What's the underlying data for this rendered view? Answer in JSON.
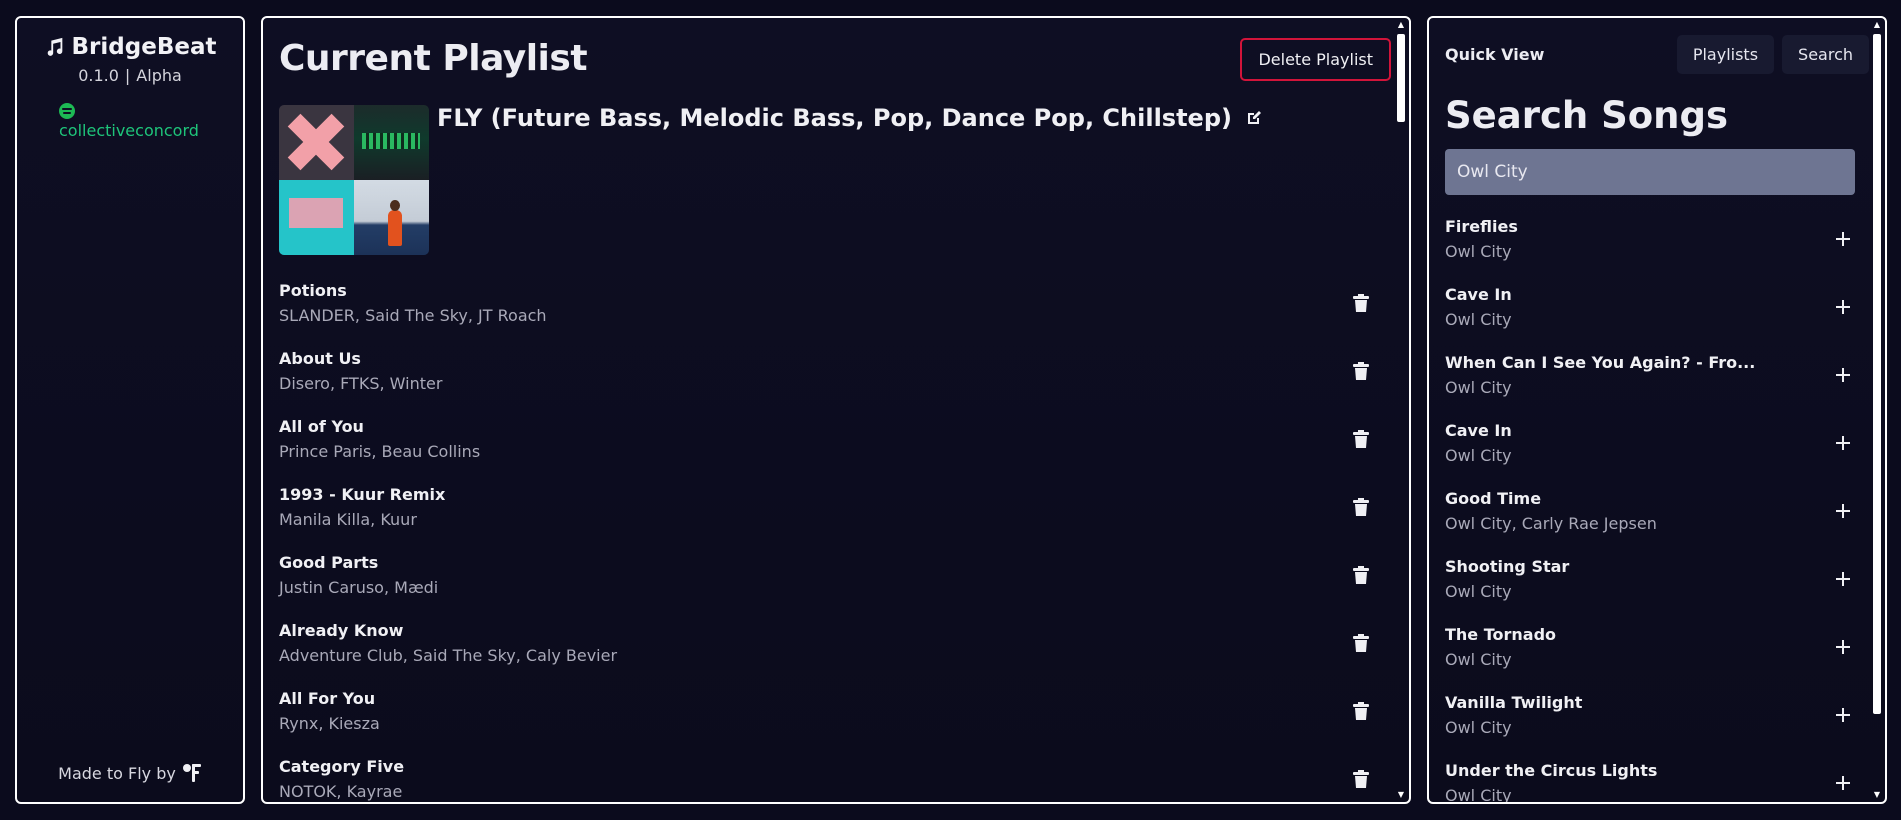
{
  "app": {
    "name": "BridgeBeat",
    "version": "0.1.0",
    "stage": "Alpha",
    "separator": "|",
    "spotify_user": "collectiveconcord",
    "made_by_label": "Made to Fly by"
  },
  "main": {
    "title": "Current Playlist",
    "delete_label": "Delete Playlist",
    "playlist_name": "FLY (Future Bass, Melodic Bass, Pop, Dance Pop, Chillstep)",
    "songs": [
      {
        "title": "Potions",
        "artist": "SLANDER, Said The Sky, JT Roach"
      },
      {
        "title": "About Us",
        "artist": "Disero, FTKS, Winter"
      },
      {
        "title": "All of You",
        "artist": "Prince Paris, Beau Collins"
      },
      {
        "title": "1993 - Kuur Remix",
        "artist": "Manila Killa, Kuur"
      },
      {
        "title": "Good Parts",
        "artist": "Justin Caruso, Mædi"
      },
      {
        "title": "Already Know",
        "artist": "Adventure Club, Said The Sky, Caly Bevier"
      },
      {
        "title": "All For You",
        "artist": "Rynx, Kiesza"
      },
      {
        "title": "Category Five",
        "artist": "NOTOK, Kayrae"
      }
    ]
  },
  "right": {
    "quick_view_label": "Quick View",
    "playlists_label": "Playlists",
    "search_label": "Search",
    "search_title": "Search Songs",
    "search_query": "Owl City",
    "results": [
      {
        "title": "Fireflies",
        "artist": "Owl City"
      },
      {
        "title": "Cave In",
        "artist": "Owl City"
      },
      {
        "title": "When Can I See You Again? - Fro...",
        "artist": "Owl City"
      },
      {
        "title": "Cave In",
        "artist": "Owl City"
      },
      {
        "title": "Good Time",
        "artist": "Owl City, Carly Rae Jepsen"
      },
      {
        "title": "Shooting Star",
        "artist": "Owl City"
      },
      {
        "title": "The Tornado",
        "artist": "Owl City"
      },
      {
        "title": "Vanilla Twilight",
        "artist": "Owl City"
      },
      {
        "title": "Under the Circus Lights",
        "artist": "Owl City"
      }
    ]
  },
  "colors": {
    "background": "#0b0b1d",
    "delete_border": "#d2143a",
    "spotify_green": "#1ec47a",
    "search_input": "#6e7592"
  }
}
